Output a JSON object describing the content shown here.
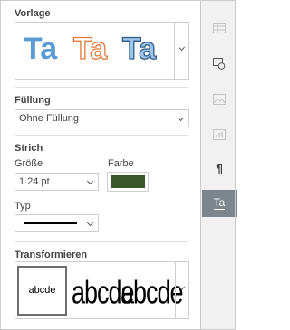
{
  "panel": {
    "preset": {
      "title": "Vorlage",
      "samples": [
        "Ta",
        "Ta",
        "Ta"
      ]
    },
    "fill": {
      "title": "Füllung",
      "value": "Ohne Füllung"
    },
    "stroke": {
      "title": "Strich",
      "size_label": "Größe",
      "size_value": "1.24 pt",
      "color_label": "Farbe",
      "color": "#38572a",
      "type_label": "Typ"
    },
    "transform": {
      "title": "Transformieren",
      "samples": [
        "abcde",
        "abcde",
        "abcde"
      ]
    }
  },
  "rightbar": {
    "items": [
      {
        "icon": "table-icon",
        "active": false
      },
      {
        "icon": "shape-icon",
        "active": false
      },
      {
        "icon": "image-icon",
        "active": false
      },
      {
        "icon": "chart-icon",
        "active": false
      },
      {
        "icon": "paragraph-icon",
        "glyph": "¶",
        "active": false
      },
      {
        "icon": "text-art-icon",
        "glyph": "Ta",
        "active": true
      }
    ]
  },
  "colors": {
    "accent_active": "#7d858c",
    "preset_blue": "#5b9bd5",
    "preset_orange": "#e07b39"
  }
}
